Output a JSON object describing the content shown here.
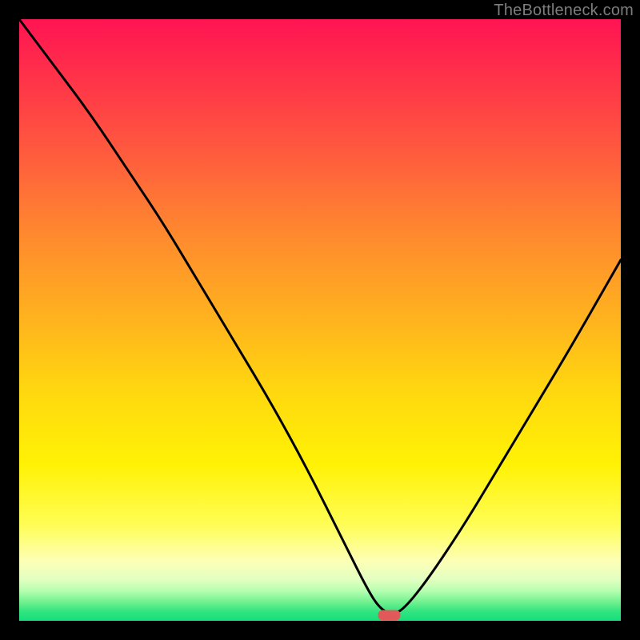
{
  "watermark": "TheBottleneck.com",
  "chart_data": {
    "type": "line",
    "title": "",
    "xlabel": "",
    "ylabel": "",
    "xlim": [
      0,
      100
    ],
    "ylim": [
      0,
      100
    ],
    "grid": false,
    "legend": false,
    "series": [
      {
        "name": "bottleneck-curve",
        "x": [
          0,
          6,
          12,
          18,
          24,
          30,
          36,
          42,
          48,
          54,
          58,
          60,
          62,
          64,
          68,
          74,
          80,
          86,
          92,
          100
        ],
        "values": [
          100,
          92,
          84,
          75,
          66,
          56,
          46,
          36,
          25,
          13,
          5,
          2,
          1,
          2,
          7,
          16,
          26,
          36,
          46,
          60
        ]
      }
    ],
    "marker": {
      "name": "optimal-point",
      "x": 61.5,
      "y": 1,
      "color": "#e15a5a"
    },
    "background_gradient": {
      "stops": [
        {
          "pos": 0.0,
          "color": "#ff1452"
        },
        {
          "pos": 0.5,
          "color": "#ffb31e"
        },
        {
          "pos": 0.74,
          "color": "#fff205"
        },
        {
          "pos": 0.9,
          "color": "#fdffb5"
        },
        {
          "pos": 0.97,
          "color": "#6cf08e"
        },
        {
          "pos": 1.0,
          "color": "#17df7c"
        }
      ]
    }
  }
}
